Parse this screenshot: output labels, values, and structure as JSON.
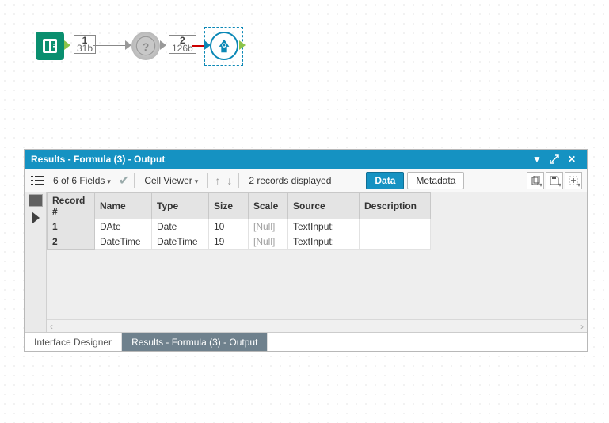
{
  "canvas": {
    "node1_anchor": {
      "num": "1",
      "size": "31b"
    },
    "node2_anchor": {
      "num": "2",
      "size": "126b"
    }
  },
  "panel": {
    "title": "Results - Formula (3) - Output",
    "fields_label": "6 of 6 Fields",
    "cell_viewer_label": "Cell Viewer",
    "records_label": "2 records displayed",
    "data_btn": "Data",
    "metadata_btn": "Metadata",
    "headers": {
      "recno": "Record #",
      "name": "Name",
      "type": "Type",
      "size": "Size",
      "scale": "Scale",
      "source": "Source",
      "desc": "Description"
    },
    "rows": [
      {
        "recno": "1",
        "name": "DAte",
        "type": "Date",
        "size": "10",
        "scale": "[Null]",
        "source": "TextInput:",
        "desc": ""
      },
      {
        "recno": "2",
        "name": "DateTime",
        "type": "DateTime",
        "size": "19",
        "scale": "[Null]",
        "source": "TextInput:",
        "desc": ""
      }
    ],
    "tab_inactive": "Interface Designer",
    "tab_active": "Results - Formula (3) - Output"
  }
}
